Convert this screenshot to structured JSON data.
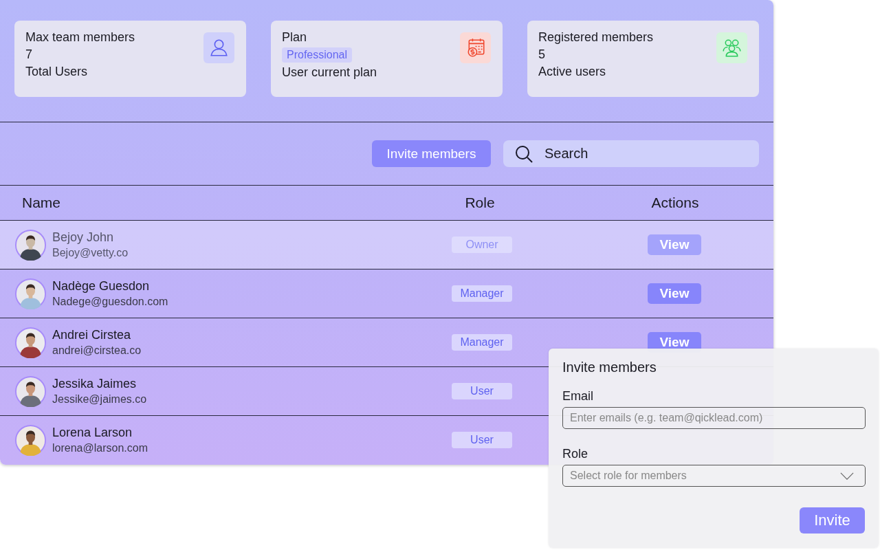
{
  "stats": [
    {
      "label": "Max team members",
      "value": "7",
      "caption": "Total Users"
    },
    {
      "label": "Plan",
      "badge": "Professional",
      "caption": "User current plan"
    },
    {
      "label": "Registered  members",
      "value": "5",
      "caption": "Active users"
    }
  ],
  "toolbar": {
    "invite_button": "Invite members",
    "search": {
      "placeholder": "Search"
    }
  },
  "table": {
    "columns": [
      "Name",
      "Role",
      "Actions"
    ],
    "rows": [
      {
        "name": "Bejoy John",
        "email": "Bejoy@vetty.co",
        "role": "Owner",
        "action": "View",
        "selected": true
      },
      {
        "name": "Nadège Guesdon",
        "email": "Nadege@guesdon.com",
        "role": "Manager",
        "action": "View",
        "selected": false
      },
      {
        "name": "Andrei Cirstea",
        "email": "andrei@cirstea.co",
        "role": "Manager",
        "action": "View",
        "selected": false
      },
      {
        "name": "Jessika Jaimes",
        "email": "Jessike@jaimes.co",
        "role": "User",
        "selected": false
      },
      {
        "name": "Lorena Larson",
        "email": "lorena@larson.com",
        "role": "User",
        "selected": false
      }
    ]
  },
  "invite_dialog": {
    "title": "Invite members",
    "email_label": "Email",
    "email": {
      "placeholder": "Enter emails (e.g. team@qicklead.com)"
    },
    "role_label": "Role",
    "role": {
      "placeholder": "Select role for members"
    },
    "submit": "Invite"
  }
}
